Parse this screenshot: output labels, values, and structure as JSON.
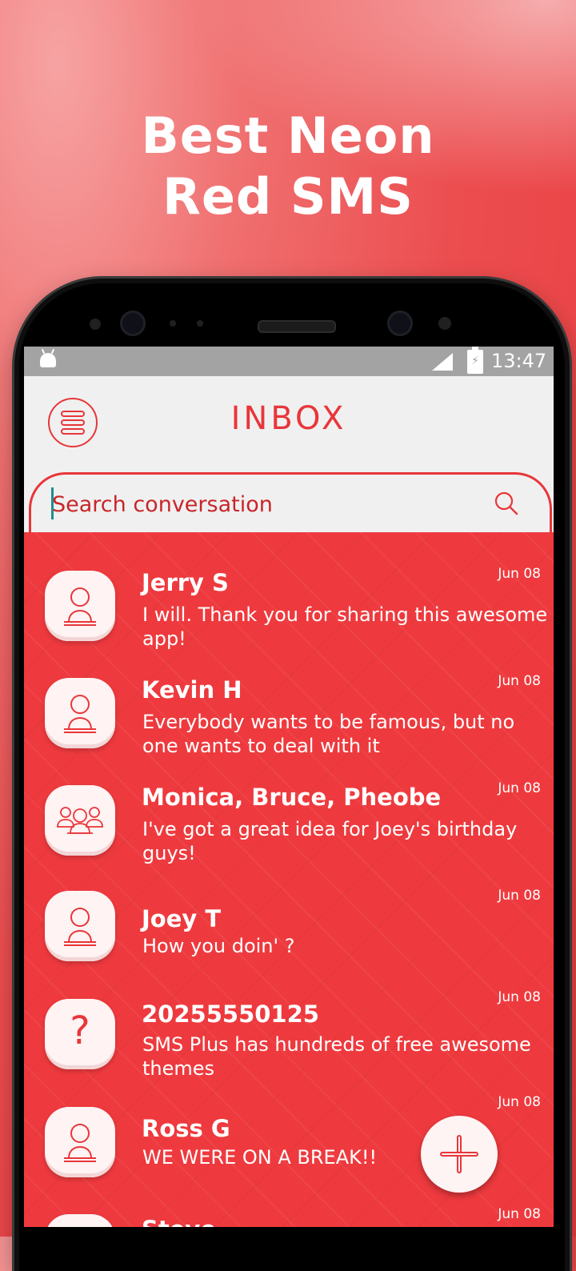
{
  "promo": {
    "line1": "Best Neon",
    "line2": "Red SMS"
  },
  "statusbar": {
    "time": "13:47"
  },
  "appbar": {
    "title": "INBOX"
  },
  "search": {
    "placeholder": "Search conversation"
  },
  "conversations": [
    {
      "name": "Jerry S",
      "snippet": "I will. Thank you for sharing this awesome app!",
      "date": "Jun 08",
      "avatar": "person-icon"
    },
    {
      "name": "Kevin H",
      "snippet": "Everybody wants to be famous, but no one wants to deal with it",
      "date": "Jun 08",
      "avatar": "person-icon"
    },
    {
      "name": "Monica, Bruce, Pheobe",
      "snippet": "I've got a great idea for Joey's birthday guys!",
      "date": "Jun 08",
      "avatar": "group-icon"
    },
    {
      "name": "Joey T",
      "snippet": "How you doin' ?",
      "date": "Jun 08",
      "avatar": "person-icon"
    },
    {
      "name": "20255550125",
      "snippet": "SMS Plus has hundreds of free awesome themes",
      "date": "Jun 08",
      "avatar": "unknown-contact-icon"
    },
    {
      "name": "Ross G",
      "snippet": "WE WERE ON A BREAK!!",
      "date": "Jun 08",
      "avatar": "person-icon"
    },
    {
      "name": "Steve",
      "snippet": "",
      "date": "Jun 08",
      "avatar": "person-icon"
    }
  ],
  "colors": {
    "accent": "#e8363a",
    "list_background": "#ee3a3e",
    "appbar_background": "#f0f0f0"
  }
}
